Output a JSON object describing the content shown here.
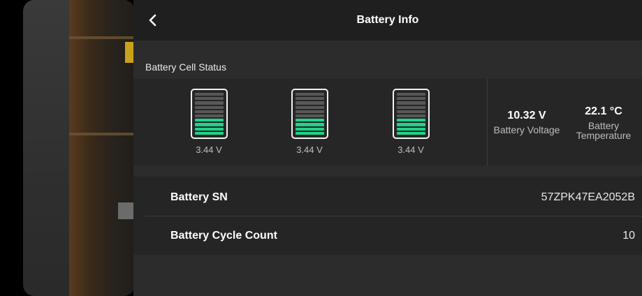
{
  "header": {
    "title": "Battery Info"
  },
  "cell_status": {
    "label": "Battery Cell Status",
    "cells": [
      {
        "voltage": "3.44 V",
        "level_fraction": 0.4
      },
      {
        "voltage": "3.44 V",
        "level_fraction": 0.4
      },
      {
        "voltage": "3.44 V",
        "level_fraction": 0.4
      }
    ],
    "voltage": {
      "value": "10.32 V",
      "label": "Battery Voltage"
    },
    "temperature": {
      "value": "22.1 °C",
      "label": "Battery\nTemperature"
    }
  },
  "details": {
    "serial": {
      "label": "Battery SN",
      "value": "57ZPK47EA2052B"
    },
    "cycles": {
      "label": "Battery Cycle Count",
      "value": "10"
    }
  },
  "colors": {
    "cell_fill": "#1fd28a",
    "cell_empty": "#585858"
  },
  "icons": {
    "back": "chevron-left-icon",
    "cell": "battery-icon"
  }
}
